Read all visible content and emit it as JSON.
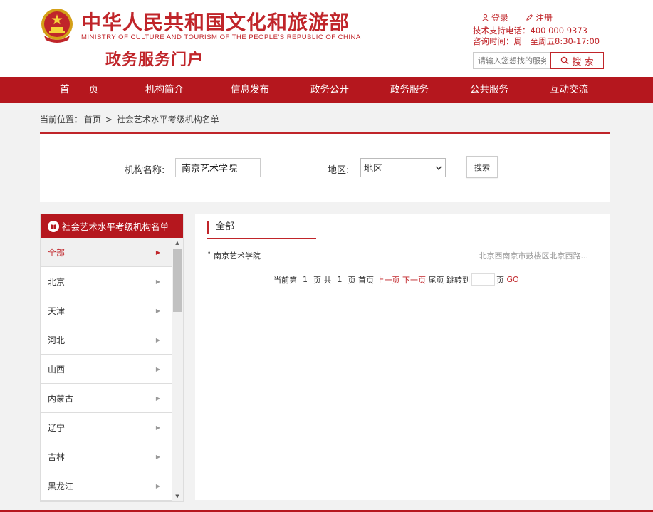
{
  "header": {
    "title_cn": "中华人民共和国文化和旅游部",
    "title_en": "MINISTRY OF CULTURE AND TOURISM OF THE PEOPLE'S REPUBLIC OF CHINA",
    "portal": "政务服务门户",
    "login": "登录",
    "register": "注册",
    "hotline": "技术支持电话：400 000 9373",
    "hours": "咨询时间：周一至周五8:30-17:00",
    "search_placeholder": "请输入您想找的服务",
    "search_button": "搜 索"
  },
  "nav": [
    "首　　页",
    "机构简介",
    "信息发布",
    "政务公开",
    "政务服务",
    "公共服务",
    "互动交流"
  ],
  "breadcrumb": {
    "label": "当前位置：",
    "home": "首页",
    "sep": ">",
    "current": "社会艺术水平考级机构名单"
  },
  "filter": {
    "name_label": "机构名称:",
    "name_value": "南京艺术学院",
    "region_label": "地区:",
    "region_value": "地区",
    "search_button": "搜索"
  },
  "sidebar": {
    "title": "社会艺术水平考级机构名单",
    "items": [
      "全部",
      "北京",
      "天津",
      "河北",
      "山西",
      "内蒙古",
      "辽宁",
      "吉林",
      "黑龙江"
    ]
  },
  "content": {
    "title": "全部",
    "results": [
      {
        "name": "南京艺术学院",
        "address": "北京西南京市鼓楼区北京西路..."
      }
    ],
    "pager": {
      "current_prefix": "当前第",
      "current_page": "1",
      "total_prefix": "页 共",
      "total_pages": "1",
      "total_suffix": "页",
      "first": "首页",
      "prev": "上一页",
      "next": "下一页",
      "last": "尾页",
      "jump_label": "跳转到",
      "jump_suffix": "页",
      "go": "GO"
    }
  },
  "colors": {
    "brand_red": "#b5171e",
    "accent_red": "#c0252a"
  }
}
